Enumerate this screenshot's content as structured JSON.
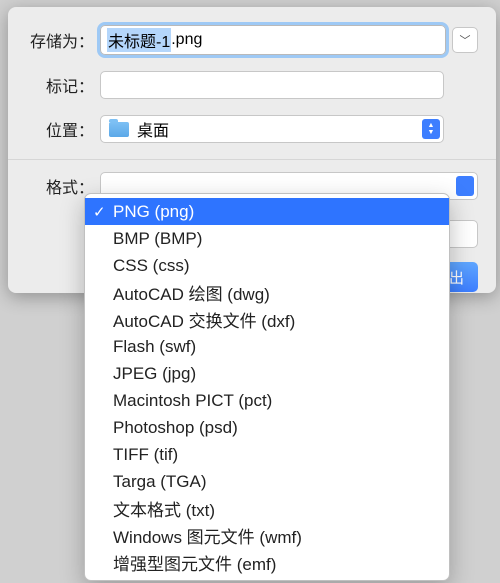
{
  "labels": {
    "save_as": "存储为：",
    "tags": "标记：",
    "location": "位置：",
    "format": "格式："
  },
  "filename": {
    "selected_part": "未标题-1",
    "rest": ".png"
  },
  "location": {
    "value": "桌面"
  },
  "buttons": {
    "export": "导出"
  },
  "format": {
    "selected_index": 0,
    "options": [
      "PNG (png)",
      "BMP (BMP)",
      "CSS (css)",
      "AutoCAD 绘图 (dwg)",
      "AutoCAD 交换文件 (dxf)",
      "Flash (swf)",
      "JPEG (jpg)",
      "Macintosh PICT (pct)",
      "Photoshop (psd)",
      "TIFF (tif)",
      "Targa (TGA)",
      "文本格式 (txt)",
      "Windows 图元文件 (wmf)",
      "增强型图元文件 (emf)"
    ]
  }
}
